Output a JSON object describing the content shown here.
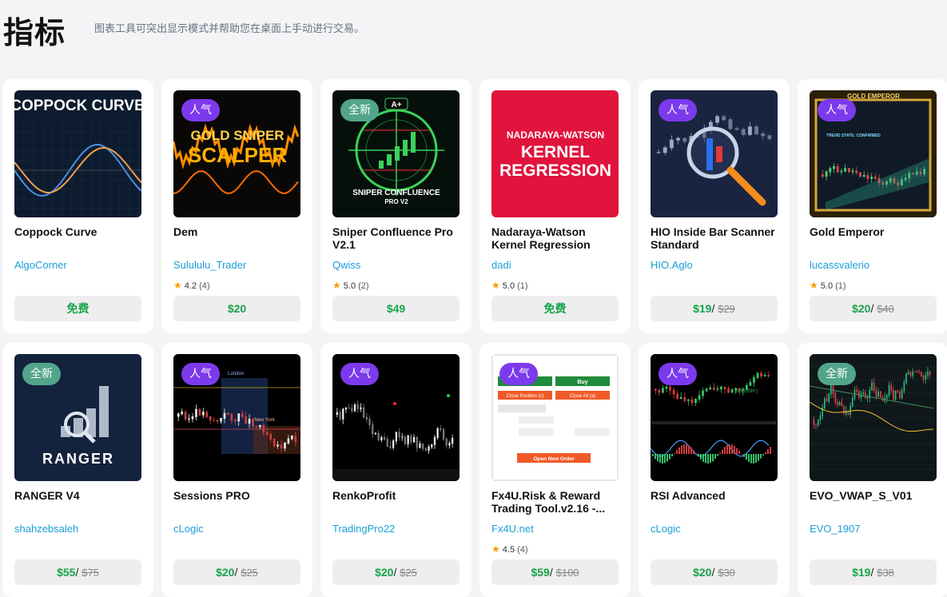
{
  "header": {
    "title": "指标",
    "subtitle": "图表工具可突出显示模式并帮助您在桌面上手动进行交易。"
  },
  "products": [
    {
      "name": "Coppock Curve",
      "author": "AlgoCorner",
      "rating": null,
      "reviews": null,
      "price": "免费",
      "old_price": null,
      "badge": null,
      "thumb": "coppock",
      "thumb_text": "COPPOCK CURVE"
    },
    {
      "name": "Dem",
      "author": "Sulululu_Trader",
      "rating": "4.2",
      "reviews": "(4)",
      "price": "$20",
      "old_price": null,
      "badge": "人气",
      "badge_type": "pop",
      "thumb": "goldsniper",
      "thumb_text": "GOLD SNIPER",
      "thumb_text2": "SCALPER"
    },
    {
      "name": "Sniper Confluence Pro V2.1",
      "author": "Qwiss",
      "rating": "5.0",
      "reviews": "(2)",
      "price": "$49",
      "old_price": null,
      "badge": "全新",
      "badge_type": "new",
      "thumb": "sniper",
      "thumb_text": "SNIPER CONFLUENCE",
      "thumb_text2": "PRO V2",
      "thumb_text3": "A+"
    },
    {
      "name": "Nadaraya-Watson Kernel Regression",
      "author": "dadi",
      "rating": "5.0",
      "reviews": "(1)",
      "price": "免费",
      "old_price": null,
      "badge": null,
      "thumb": "kernel",
      "thumb_text": "NADARAYA-WATSON",
      "thumb_text2": "KERNEL",
      "thumb_text3": "REGRESSION"
    },
    {
      "name": "HIO Inside Bar Scanner Standard",
      "author": "HIO.Aglo",
      "rating": null,
      "reviews": null,
      "price": "$19",
      "old_price": "$29",
      "badge": "人气",
      "badge_type": "pop",
      "thumb": "hio"
    },
    {
      "name": "Gold Emperor",
      "author": "lucassvalerio",
      "rating": "5.0",
      "reviews": "(1)",
      "price": "$20",
      "old_price": "$40",
      "badge": "人气",
      "badge_type": "pop",
      "thumb": "goldemperor",
      "thumb_text": "GOLD EMPEROR",
      "thumb_text2": "TREND STATE: CONFIRMED"
    },
    {
      "name": "RANGER V4",
      "author": "shahzebsaleh",
      "rating": null,
      "reviews": null,
      "price": "$55",
      "old_price": "$75",
      "badge": "全新",
      "badge_type": "new",
      "thumb": "ranger",
      "thumb_text": "RANGER"
    },
    {
      "name": "Sessions PRO",
      "author": "cLogic",
      "rating": null,
      "reviews": null,
      "price": "$20",
      "old_price": "$25",
      "badge": "人气",
      "badge_type": "pop",
      "thumb": "sessions",
      "thumb_text": "London",
      "thumb_text2": "New York"
    },
    {
      "name": "RenkoProfit",
      "author": "TradingPro22",
      "rating": null,
      "reviews": null,
      "price": "$20",
      "old_price": "$25",
      "badge": "人气",
      "badge_type": "pop",
      "thumb": "renko"
    },
    {
      "name": "Fx4U.Risk & Reward Trading Tool.v2.16 -...",
      "author": "Fx4U.net",
      "rating": "4.5",
      "reviews": "(4)",
      "price": "$59",
      "old_price": "$100",
      "badge": "人气",
      "badge_type": "pop",
      "thumb": "fx4u",
      "thumb_text": "Order",
      "thumb_text2": "Buy",
      "thumb_text3": "Close Position (c)",
      "thumb_text4": "Close All (a)",
      "thumb_text5": "Open New Order"
    },
    {
      "name": "RSI Advanced",
      "author": "cLogic",
      "rating": null,
      "reviews": null,
      "price": "$20",
      "old_price": "$30",
      "badge": "人气",
      "badge_type": "pop",
      "thumb": "rsi",
      "thumb_text": "[ BULLISH ]"
    },
    {
      "name": "EVO_VWAP_S_V01",
      "author": "EVO_1907",
      "rating": null,
      "reviews": null,
      "price": "$19",
      "old_price": "$38",
      "badge": "全新",
      "badge_type": "new",
      "thumb": "evo"
    }
  ],
  "colors": {
    "accent_price": "#16a34a",
    "author_link": "#1a9fd6",
    "badge_popular": "#7c3aed",
    "badge_new": "#52a58a",
    "star": "#f5a000"
  },
  "icons": {
    "rating": "star-icon"
  }
}
